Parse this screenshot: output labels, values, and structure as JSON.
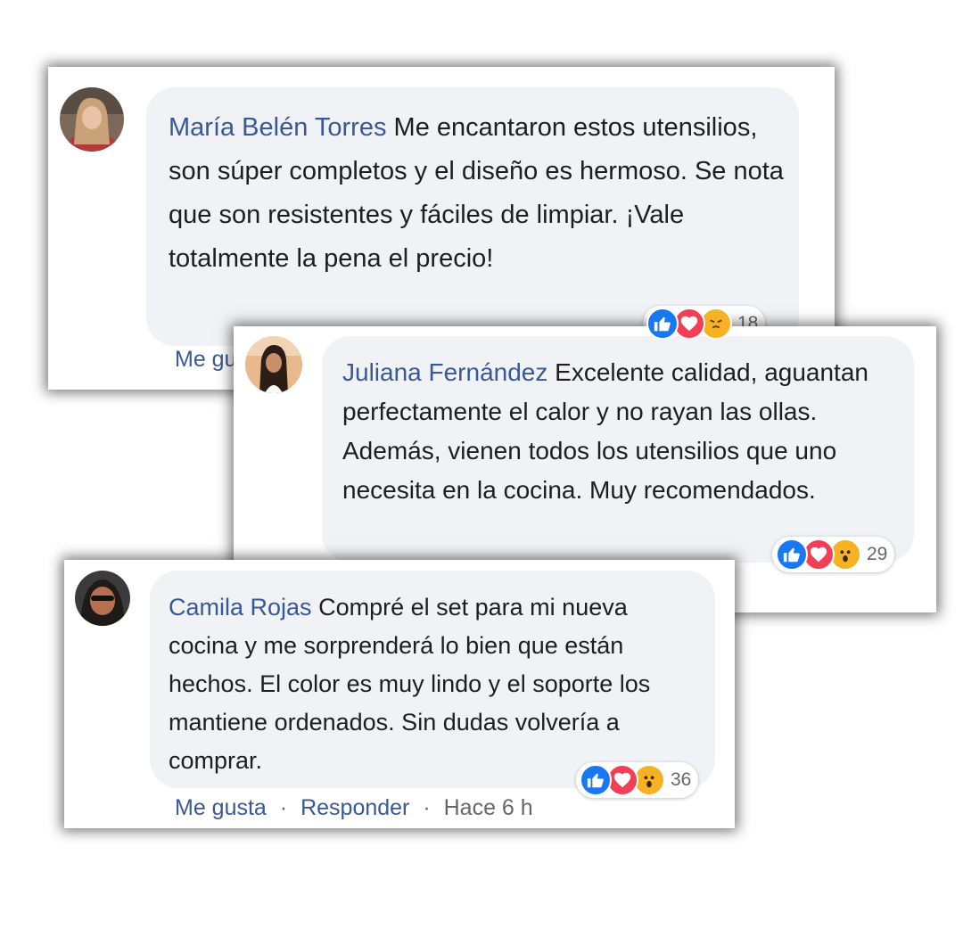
{
  "comments": [
    {
      "author": "María Belén Torres",
      "text": "Me encantaron estos utensilios, son súper completos y el diseño es hermoso. Se nota que son resistentes y fáciles de limpiar. ¡Vale totalmente la pena el precio!",
      "reaction_count": "18",
      "reactions": [
        "like-icon",
        "love-icon",
        "angry-icon"
      ],
      "actions": {
        "like": "Me gusta"
      }
    },
    {
      "author": "Juliana Fernández",
      "text": "Excelente calidad, aguantan perfectamente el calor y no rayan las ollas. Además, vienen todos los utensilios que uno necesita en la cocina. Muy recomendados.",
      "reaction_count": "29",
      "reactions": [
        "like-icon",
        "love-icon",
        "wow-icon"
      ]
    },
    {
      "author": "Camila Rojas",
      "text": "Compré el set para mi nueva cocina y me sorprenderá lo bien que están hechos. El color es muy lindo y el soporte los mantiene ordenados. Sin dudas volvería a comprar.",
      "reaction_count": "36",
      "reactions": [
        "like-icon",
        "love-icon",
        "wow-icon"
      ],
      "actions": {
        "like": "Me gusta",
        "separator": "·",
        "reply": "Responder",
        "time": "Hace 6 h"
      }
    }
  ],
  "colors": {
    "author": "#385898",
    "bubble": "#f0f2f5",
    "like": "#1877f2",
    "love": "#f33e58",
    "wow": "#f7b125"
  }
}
